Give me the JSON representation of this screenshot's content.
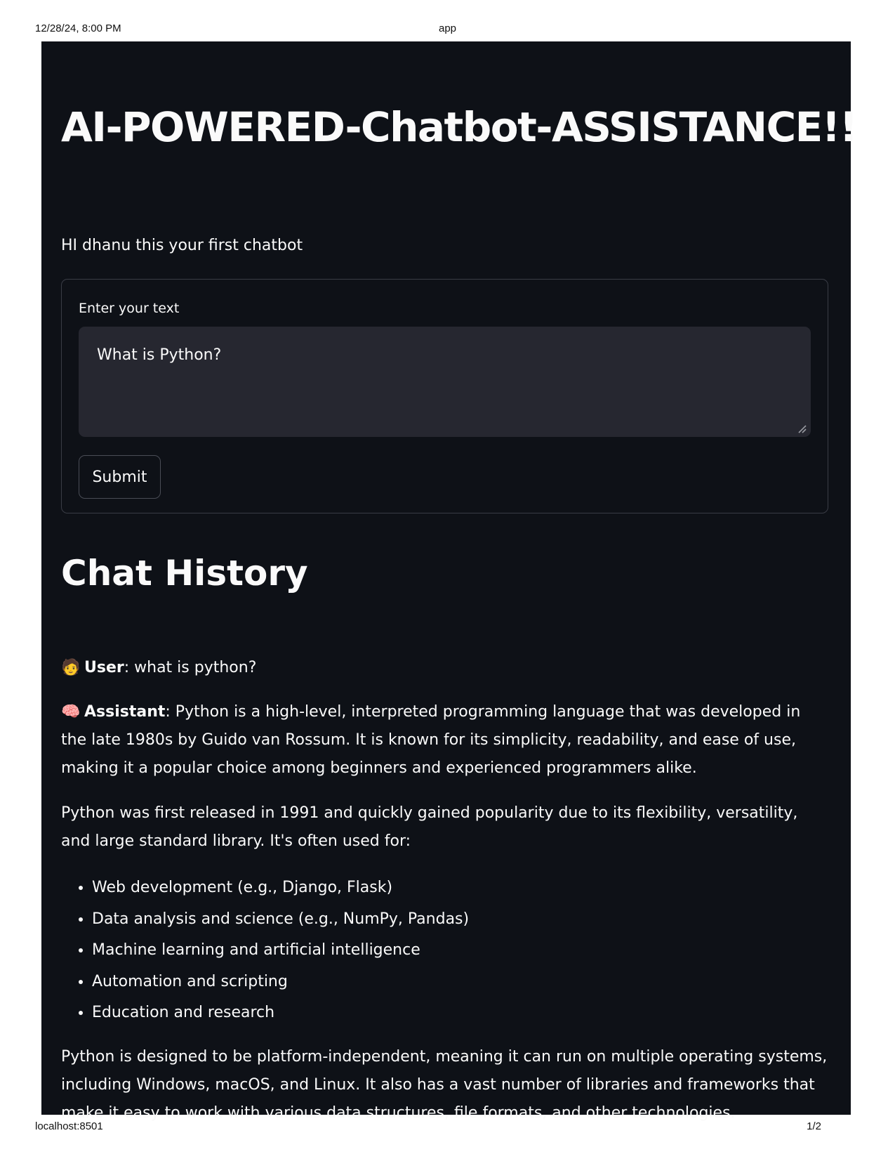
{
  "print_header": {
    "datetime": "12/28/24, 8:00 PM",
    "page_title": "app"
  },
  "print_footer": {
    "url": "localhost:8501",
    "page_number": "1/2"
  },
  "app": {
    "title": "AI-POWERED-Chatbot-ASSISTANCE!!",
    "caption": "HI dhanu this your first chatbot",
    "form": {
      "label": "Enter your text",
      "input_value": "What is Python?",
      "submit_label": "Submit"
    },
    "history": {
      "heading": "Chat History",
      "user_emoji": "🧑",
      "user_role": "User",
      "user_text": ": what is python?",
      "assistant_emoji": "🧠",
      "assistant_role": "Assistant",
      "assistant_intro": ": Python is a high-level, interpreted programming language that was developed in the late 1980s by Guido van Rossum. It is known for its simplicity, readability, and ease of use, making it a popular choice among beginners and experienced programmers alike.",
      "paragraph_2": "Python was first released in 1991 and quickly gained popularity due to its flexibility, versatility, and large standard library. It's often used for:",
      "uses": [
        "Web development (e.g., Django, Flask)",
        "Data analysis and science (e.g., NumPy, Pandas)",
        "Machine learning and artificial intelligence",
        "Automation and scripting",
        "Education and research"
      ],
      "paragraph_3": "Python is designed to be platform-independent, meaning it can run on multiple operating systems, including Windows, macOS, and Linux. It also has a vast number of libraries and frameworks that make it easy to work with various data structures, file formats, and other technologies."
    }
  }
}
